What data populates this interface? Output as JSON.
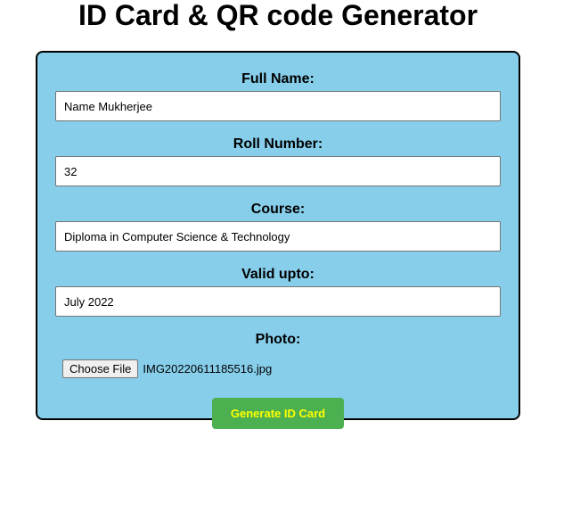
{
  "header": {
    "title": "ID Card & QR code Generator"
  },
  "form": {
    "full_name": {
      "label": "Full Name:",
      "value": "Name Mukherjee"
    },
    "roll_number": {
      "label": "Roll Number:",
      "value": "32"
    },
    "course": {
      "label": "Course:",
      "value": "Diploma in Computer Science & Technology"
    },
    "valid_upto": {
      "label": "Valid upto:",
      "value": "July 2022"
    },
    "photo": {
      "label": "Photo:",
      "button_label": "Choose File",
      "file_name": "IMG20220611185516.jpg"
    },
    "submit_label": "Generate ID Card"
  },
  "colors": {
    "card_background": "#87ceeb",
    "submit_background": "#4caf50",
    "submit_text": "#ffff00"
  }
}
